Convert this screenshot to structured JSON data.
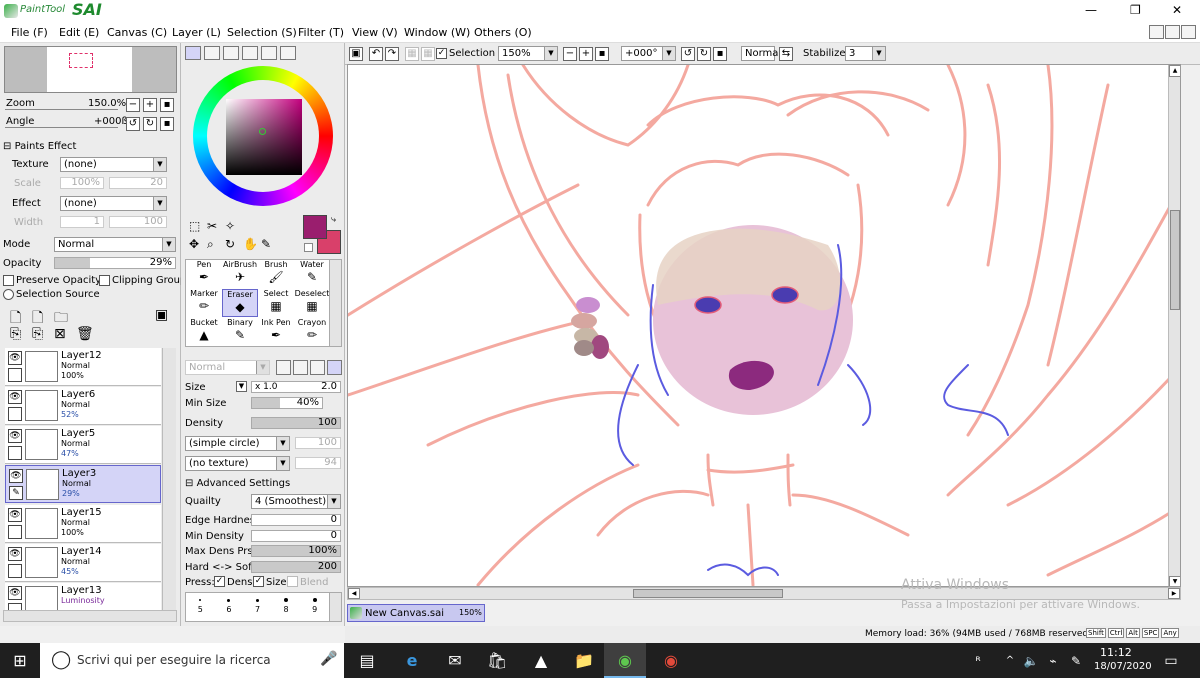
{
  "app": {
    "logo_prefix": "PaintTool",
    "logo_name": "SAI"
  },
  "window_controls": {
    "minimize": "—",
    "restore": "❐",
    "close": "✕"
  },
  "menu": [
    "File (F)",
    "Edit (E)",
    "Canvas (C)",
    "Layer (L)",
    "Selection (S)",
    "Filter (T)",
    "View (V)",
    "Window (W)",
    "Others (O)"
  ],
  "navigator": {
    "zoom_label": "Zoom",
    "zoom_value": "150.0%",
    "angle_label": "Angle",
    "angle_value": "+000ß"
  },
  "paints_effect": {
    "header": "Paints Effect",
    "texture_label": "Texture",
    "texture_value": "(none)",
    "scale_label": "Scale",
    "scale_value": "100%",
    "scale_num": "20",
    "effect_label": "Effect",
    "effect_value": "(none)",
    "width_label": "Width",
    "width_value": "1",
    "width_num": "100"
  },
  "layer_props": {
    "mode_label": "Mode",
    "mode_value": "Normal",
    "opacity_label": "Opacity",
    "opacity_value": "29%",
    "opacity_fraction": 0.29,
    "preserve_opacity": "Preserve Opacity",
    "clipping_group": "Clipping Group",
    "selection_source": "Selection Source"
  },
  "layers": [
    {
      "name": "Layer12",
      "mode": "Normal",
      "opacity": "100%",
      "selected": false
    },
    {
      "name": "Layer6",
      "mode": "Normal",
      "opacity": "52%",
      "selected": false
    },
    {
      "name": "Layer5",
      "mode": "Normal",
      "opacity": "47%",
      "selected": false
    },
    {
      "name": "Layer3",
      "mode": "Normal",
      "opacity": "29%",
      "selected": true
    },
    {
      "name": "Layer15",
      "mode": "Normal",
      "opacity": "100%",
      "selected": false
    },
    {
      "name": "Layer14",
      "mode": "Normal",
      "opacity": "45%",
      "selected": false
    },
    {
      "name": "Layer13",
      "mode": "Luminosity",
      "opacity": "",
      "selected": false
    }
  ],
  "colors": {
    "primary": "#9a1e6e",
    "secondary": "#d9406a",
    "accent_select": "#d4d4f7",
    "sv_hue": "#c4007e"
  },
  "tools": [
    {
      "label": "Pen",
      "icon": "pen-icon",
      "glyph": "✒"
    },
    {
      "label": "AirBrush",
      "icon": "airbrush-icon",
      "glyph": "✈"
    },
    {
      "label": "Brush",
      "icon": "brush-icon",
      "glyph": "🖌"
    },
    {
      "label": "Water",
      "icon": "water-icon",
      "glyph": "✎"
    },
    {
      "label": "Marker",
      "icon": "marker-icon",
      "glyph": "✏"
    },
    {
      "label": "Eraser",
      "icon": "eraser-icon",
      "glyph": "◆"
    },
    {
      "label": "Select",
      "icon": "select-icon",
      "glyph": "▦"
    },
    {
      "label": "Deselect",
      "icon": "deselect-icon",
      "glyph": "▦"
    },
    {
      "label": "Bucket",
      "icon": "bucket-icon",
      "glyph": "▲"
    },
    {
      "label": "Binary",
      "icon": "binary-icon",
      "glyph": "✎"
    },
    {
      "label": "Ink Pen",
      "icon": "inkpen-icon",
      "glyph": "✒"
    },
    {
      "label": "Crayon",
      "icon": "crayon-icon",
      "glyph": "✏"
    }
  ],
  "selected_tool": "Eraser",
  "brush": {
    "blend_mode": "Normal",
    "size_label": "Size",
    "size_mult": "x 1.0",
    "size_value": "2.0",
    "min_size_label": "Min Size",
    "min_size_value": "40%",
    "min_size_fraction": 0.4,
    "density_label": "Density",
    "density_value": "100",
    "density_fraction": 1.0,
    "shape": "(simple circle)",
    "shape_num": "100",
    "texture": "(no texture)",
    "texture_num": "94",
    "advanced_header": "Advanced Settings",
    "quality_label": "Quailty",
    "quality_value": "4 (Smoothest)",
    "edge_hardness_label": "Edge Hardness",
    "edge_hardness_value": "0",
    "min_density_label": "Min Density",
    "min_density_value": "0",
    "max_dens_label": "Max Dens Prs.",
    "max_dens_value": "100%",
    "max_dens_fraction": 1.0,
    "hard_soft_label": "Hard <-> Soft",
    "hard_soft_value": "200",
    "hard_soft_fraction": 1.0,
    "press_label": "Press:",
    "press_dens": "Dens",
    "press_size": "Size",
    "press_blend": "Blend"
  },
  "brush_sizes": [
    "5",
    "6",
    "7",
    "8",
    "9"
  ],
  "canvas_toolbar": {
    "selection_label": "Selection",
    "zoom_value": "150%",
    "angle_value": "+000°",
    "blend_value": "Normal",
    "stabilizer_label": "Stabilizer",
    "stabilizer_value": "3"
  },
  "document_tab": {
    "name": "New Canvas.sai",
    "zoom": "150%"
  },
  "watermark": {
    "line1": "Attiva Windows",
    "line2": "Passa a Impostazioni per attivare Windows."
  },
  "status": {
    "memory": "Memory load: 36% (94MB used / 768MB reserved)",
    "keys": [
      "Shift",
      "Ctrl",
      "Alt",
      "SPC",
      "Any"
    ]
  },
  "taskbar": {
    "search_placeholder": "Scrivi qui per eseguire la ricerca",
    "time": "11:12",
    "date": "18/07/2020"
  }
}
